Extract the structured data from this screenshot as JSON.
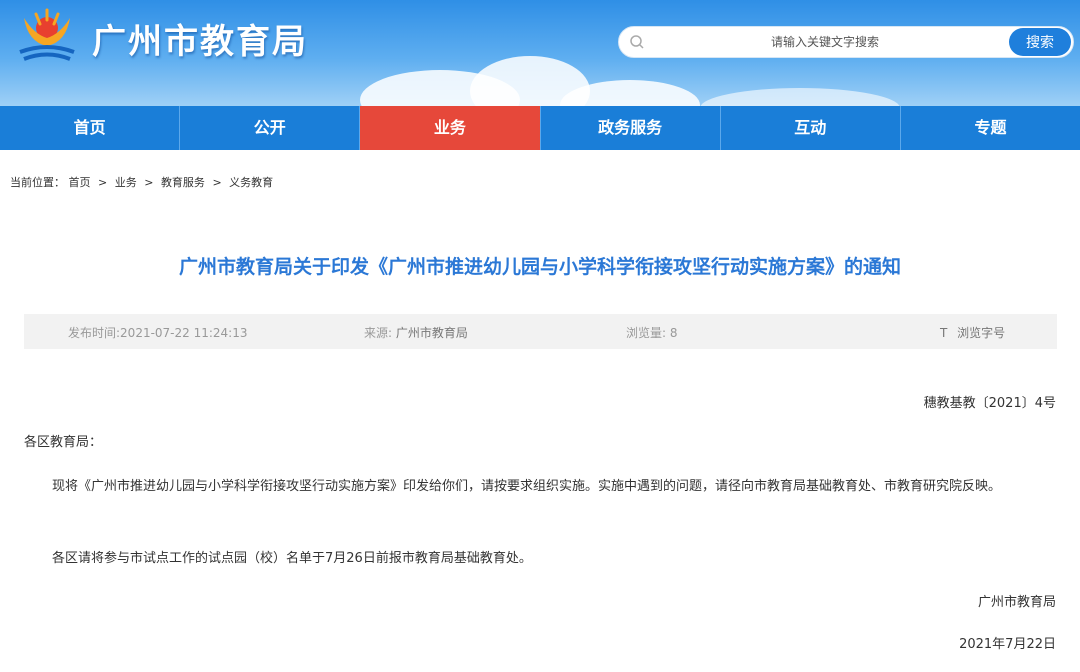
{
  "header": {
    "site_name": "广州市教育局",
    "search": {
      "placeholder": "请输入关键文字搜索",
      "button_label": "搜索"
    }
  },
  "nav": {
    "items": [
      {
        "label": "首页"
      },
      {
        "label": "公开"
      },
      {
        "label": "业务"
      },
      {
        "label": "政务服务"
      },
      {
        "label": "互动"
      },
      {
        "label": "专题"
      }
    ],
    "active_index": 2
  },
  "breadcrumb": {
    "prefix": "当前位置：",
    "items": [
      "首页",
      "业务",
      "教育服务",
      "义务教育"
    ],
    "separator": ">"
  },
  "article": {
    "title": "广州市教育局关于印发《广州市推进幼儿园与小学科学衔接攻坚行动实施方案》的通知",
    "meta": {
      "publish_time": "发布时间:2021-07-22 11:24:13",
      "source_label": "来源:",
      "source": "广州市教育局",
      "views_label": "浏览量:",
      "views": "8",
      "font_icon": "T",
      "font_label": "浏览字号"
    },
    "doc_number": "穗教基教〔2021〕4号",
    "salutation": "各区教育局：",
    "paragraphs": [
      "现将《广州市推进幼儿园与小学科学衔接攻坚行动实施方案》印发给你们，请按要求组织实施。实施中遇到的问题，请径向市教育局基础教育处、市教育研究院反映。",
      "各区请将参与市试点工作的试点园（校）名单于7月26日前报市教育局基础教育处。"
    ],
    "signature": "广州市教育局",
    "date": "2021年7月22日"
  },
  "colors": {
    "header_blue": "#2f8fe6",
    "nav_blue": "#1a7ed8",
    "nav_active": "#e6483a",
    "title_blue": "#2b78d6",
    "meta_bg": "#f2f2f2"
  },
  "icons": {
    "logo": "bureau-logo",
    "search": "search-icon"
  }
}
